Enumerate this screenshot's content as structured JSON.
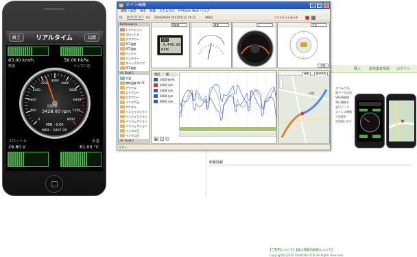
{
  "phone": {
    "header": {
      "title": "リアルタイム",
      "left_button": "終了",
      "right_button": "記録"
    },
    "left_metric": {
      "value": "83.00 km/h",
      "label": "車速"
    },
    "right_metric": {
      "value": "58.00 hkPa",
      "label": "インマニ圧"
    },
    "gauge": {
      "title": "回転数",
      "value": "3428.00 rpm",
      "min": "MIN : 0.00",
      "max": "MAX : 5007.00",
      "ticks": [
        "0",
        "800",
        "1600",
        "2400",
        "3200",
        "4000",
        "4800",
        "5600",
        "6400",
        "7200",
        "8000"
      ],
      "needle_fraction": 0.43
    },
    "bottom_left": {
      "label": "スロットル",
      "value": "29.80 V"
    },
    "bottom_right": {
      "label": "水温",
      "value": "81.00 °C"
    }
  },
  "app": {
    "title": "メイン画面",
    "menus": [
      "接続・設定",
      "表示",
      "記録",
      "ステムクロ",
      "P-Phone",
      "Web",
      "ヘルプ"
    ],
    "toolbar": [
      "01",
      "3053 04 00",
      "03",
      "2003/06/29 2011/01/12 14:13",
      "OBD2",
      "リアルタイム表示中"
    ],
    "left_panel": {
      "header1": "Performance",
      "items1": [
        "トラクション",
        "スロットル",
        "エアフロー",
        "ATF温度",
        "ATF温度",
        "バッテリ",
        "バッテリー",
        "ストップランプ",
        "ATF温度"
      ],
      "header2": "Air Fluid 1",
      "items2": [
        "水温",
        "燃料温度 IN 71",
        "アクセル",
        "エアフロー",
        "エアフロー",
        "インマニ圧",
        "アクセル",
        "インジェクション",
        "インジェクション",
        "インジェクション",
        "インジェクション",
        "インマニ圧",
        "インマニ圧"
      ],
      "header3": "Air Fluid 1"
    },
    "rpm_pane": {
      "selector": "回転数",
      "unit_label": "RPM",
      "value": "4,440.00"
    },
    "speed_pane": {
      "selector": "車速"
    },
    "compass_pane": {
      "selector": "方位"
    },
    "graph_pane": {
      "table_headers": [
        "項目",
        "値"
      ],
      "rows": [
        {
          "value": "3000 km/h",
          "color": "#3355cc"
        },
        {
          "value": "4000 rpm",
          "color": "#cc3333"
        },
        {
          "value": "3000 rpm",
          "color": "#3355cc"
        },
        {
          "value": "5000 rpm",
          "color": "#3355cc"
        },
        {
          "value": "6000 rpm",
          "color": "#3355cc"
        }
      ]
    },
    "map_pane": {
      "tab1": "地図",
      "tab2": "航空写真",
      "place": "大崎"
    },
    "status": "リスト"
  },
  "webpage": {
    "nav": [
      "",
      "購入",
      "関係業者情報",
      "ログイン"
    ],
    "body_text": [
      "ステムです。",
      "車データの記",
      "SNS情報量",
      "車に機能を",
      "走行データ",
      "ストレス情報",
      "で記録を",
      "の記録に出す"
    ],
    "news_label": "新着情報",
    "footer_links": "【ご利用について】【個人情報の取扱について】",
    "copyright": "Copyright(C)2010 StreetStar LTD. All Rights Reserved"
  },
  "colors": {
    "accent": "#f08010",
    "titlebar": "#2a5fc8",
    "gauge_bar": "#3fb53f",
    "needle": "#ff6a00"
  }
}
